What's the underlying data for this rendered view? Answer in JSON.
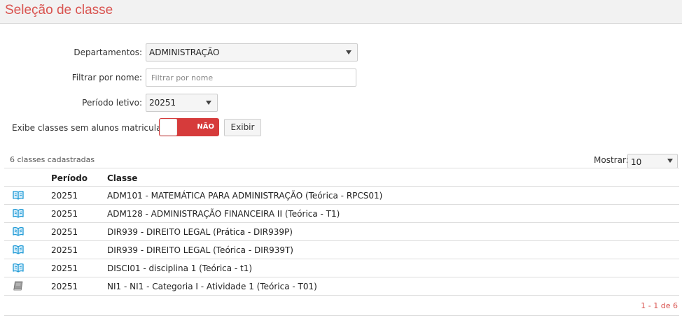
{
  "header": {
    "title": "Seleção de classe"
  },
  "filters": {
    "departamentos_label": "Departamentos:",
    "departamentos_value": "ADMINISTRAÇÃO",
    "nome_label": "Filtrar por nome:",
    "nome_placeholder": "Filtrar por nome",
    "nome_value": "",
    "periodo_label": "Período letivo:",
    "periodo_value": "20251",
    "exibe_label": "Exibe classes sem alunos matriculados:",
    "toggle_state": "NÃO",
    "exibir_button": "Exibir"
  },
  "list": {
    "count_text": "6 classes cadastradas",
    "show_label": "Mostrar:",
    "show_value": "10",
    "columns": [
      "Período",
      "Classe"
    ],
    "rows": [
      {
        "icon": "open-book-icon",
        "period": "20251",
        "classe": "ADM101 - MATEMÁTICA PARA ADMINISTRAÇÃO (Teórica - RPCS01)"
      },
      {
        "icon": "open-book-icon",
        "period": "20251",
        "classe": "ADM128 - ADMINISTRAÇÃO FINANCEIRA II (Teórica - T1)"
      },
      {
        "icon": "open-book-icon",
        "period": "20251",
        "classe": "DIR939 - DIREITO LEGAL (Prática - DIR939P)"
      },
      {
        "icon": "open-book-icon",
        "period": "20251",
        "classe": "DIR939 - DIREITO LEGAL (Teórica - DIR939T)"
      },
      {
        "icon": "open-book-icon",
        "period": "20251",
        "classe": "DISCI01 - disciplina 1 (Teórica - t1)"
      },
      {
        "icon": "closed-book-icon",
        "period": "20251",
        "classe": "NI1 - NI1 - Categoria I - Atividade 1 (Teórica - T01)"
      }
    ],
    "pagination": "1 - 1 de 6"
  },
  "colors": {
    "accent": "#d9534f",
    "toggle_off": "#d63b3b",
    "open_book_icon": "#1f9ad6",
    "closed_book_icon": "#8c8c8c"
  }
}
